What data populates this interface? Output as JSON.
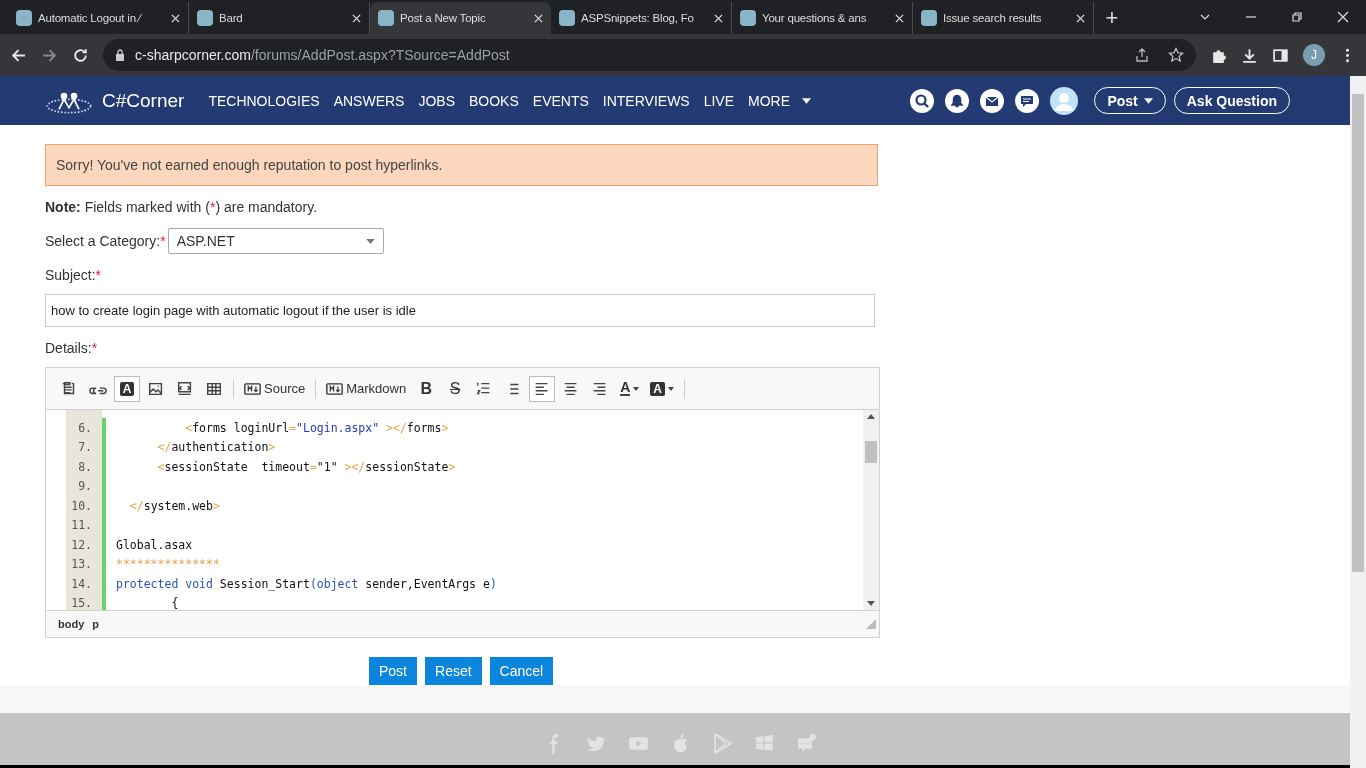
{
  "browser": {
    "tabs": [
      {
        "title": "Automatic Logout in ⁄",
        "selected": false
      },
      {
        "title": "Bard",
        "selected": false
      },
      {
        "title": "Post a New Topic",
        "selected": true
      },
      {
        "title": "ASPSnippets: Blog, Fo",
        "selected": false
      },
      {
        "title": "Your questions & ans",
        "selected": false
      },
      {
        "title": "Issue search results",
        "selected": false
      }
    ],
    "new_tab": "+",
    "url_host": "c-sharpcorner.com",
    "url_path": "/forums/AddPost.aspx?TSource=AddPost",
    "profile": "J"
  },
  "site": {
    "logo": "C#Corner",
    "nav": [
      "TECHNOLOGIES",
      "ANSWERS",
      "JOBS",
      "BOOKS",
      "EVENTS",
      "INTERVIEWS",
      "LIVE",
      "MORE"
    ],
    "post_button": "Post",
    "ask_button": "Ask Question"
  },
  "alert": "Sorry! You've not earned enough reputation to post hyperlinks.",
  "note": {
    "label": "Note:",
    "text": "Fields marked with (",
    "star": "*",
    "text_end": ") are mandatory."
  },
  "category": {
    "label": "Select a Category:",
    "required": true,
    "value": "ASP.NET"
  },
  "subject": {
    "label": "Subject:",
    "required": true,
    "value": "how to create login page with automatic logout if the user is idle"
  },
  "details": {
    "label": "Details:",
    "required": true
  },
  "toolbar": [
    {
      "kind": "icon",
      "selected": false
    },
    {
      "kind": "icon",
      "selected": false
    },
    {
      "kind": "boxed",
      "label": "A",
      "selected": true
    },
    {
      "kind": "icon",
      "selected": false
    },
    {
      "kind": "icon",
      "selected": false
    },
    {
      "kind": "icon",
      "selected": false
    },
    {
      "kind": "separator"
    },
    {
      "kind": "labeled",
      "label": "Source",
      "selected": false
    },
    {
      "kind": "separator"
    },
    {
      "kind": "labeled",
      "label": "Markdown",
      "selected": false
    },
    {
      "kind": "bold",
      "label": "B",
      "selected": false
    },
    {
      "kind": "strike",
      "label": "S",
      "selected": false
    },
    {
      "kind": "icon",
      "selected": false
    },
    {
      "kind": "icon",
      "selected": false
    },
    {
      "kind": "icon",
      "selected": true
    },
    {
      "kind": "icon",
      "selected": false
    },
    {
      "kind": "icon",
      "selected": false
    },
    {
      "kind": "color-dropdown",
      "label": "A",
      "selected": false
    },
    {
      "kind": "bg-dropdown",
      "label": "A",
      "selected": false
    },
    {
      "kind": "separator"
    }
  ],
  "code_lines": [
    {
      "number": "6.",
      "tokens": [
        {
          "kind": "punct",
          "text": "          <"
        },
        {
          "kind": "plain",
          "text": "forms loginUrl"
        },
        {
          "kind": "punct",
          "text": "="
        },
        {
          "kind": "string",
          "text": "\"Login.aspx\""
        },
        {
          "kind": "punct",
          "text": " ></"
        },
        {
          "kind": "plain",
          "text": "forms"
        },
        {
          "kind": "punct",
          "text": ">"
        }
      ]
    },
    {
      "number": "7.",
      "tokens": [
        {
          "kind": "punct",
          "text": "      </"
        },
        {
          "kind": "plain",
          "text": "authentication"
        },
        {
          "kind": "punct",
          "text": ">"
        }
      ]
    },
    {
      "number": "8.",
      "tokens": [
        {
          "kind": "punct",
          "text": "      <"
        },
        {
          "kind": "plain",
          "text": "sessionState  timeout"
        },
        {
          "kind": "punct",
          "text": "="
        },
        {
          "kind": "plain",
          "text": "\"1\""
        },
        {
          "kind": "punct",
          "text": " ></"
        },
        {
          "kind": "plain",
          "text": "sessionState"
        },
        {
          "kind": "punct",
          "text": ">"
        }
      ]
    },
    {
      "number": "9."
    },
    {
      "number": "10.",
      "tokens": [
        {
          "kind": "punct",
          "text": "  </"
        },
        {
          "kind": "plain",
          "text": "system.web"
        },
        {
          "kind": "punct",
          "text": ">"
        }
      ]
    },
    {
      "number": "11."
    },
    {
      "number": "12.",
      "tokens": [
        {
          "kind": "plain",
          "text": "Global.asax"
        }
      ]
    },
    {
      "number": "13.",
      "tokens": [
        {
          "kind": "punct",
          "text": "***************"
        }
      ]
    },
    {
      "number": "14.",
      "tokens": [
        {
          "kind": "keyword",
          "text": "protected void "
        },
        {
          "kind": "plain",
          "text": "Session_Start"
        },
        {
          "kind": "keyword",
          "text": "(object "
        },
        {
          "kind": "plain",
          "text": "sender,EventArgs e"
        },
        {
          "kind": "keyword",
          "text": ")"
        }
      ]
    },
    {
      "number": "15.",
      "tokens": [
        {
          "kind": "plain",
          "text": "        {"
        }
      ]
    }
  ],
  "status_path": [
    "body",
    "p"
  ],
  "buttons": [
    "Post",
    "Reset",
    "Cancel"
  ]
}
